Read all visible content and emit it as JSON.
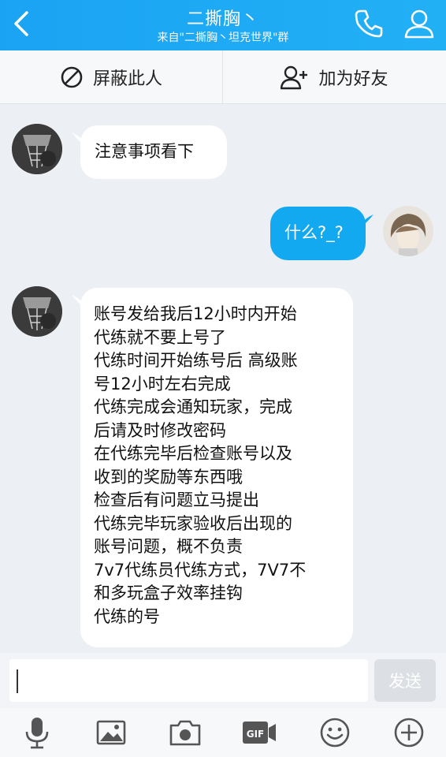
{
  "header": {
    "title": "二撕胸丶",
    "subtitle": "来自\"二撕胸丶坦克世界\"群"
  },
  "actions": {
    "block_label": "屏蔽此人",
    "add_friend_label": "加为好友"
  },
  "messages": [
    {
      "side": "left",
      "text": "注意事项看下"
    },
    {
      "side": "right",
      "text": "什么?_?"
    },
    {
      "side": "left",
      "lines": [
        "账号发给我后12小时内开始",
        "代练就不要上号了",
        "代练时间开始练号后 高级账",
        "号12小时左右完成",
        "代练完成会通知玩家，完成",
        "后请及时修改密码",
        "在代练完毕后检查账号以及",
        "收到的奖励等东西哦",
        "检查后有问题立马提出",
        "代练完毕玩家验收后出现的",
        "账号问题，概不负责",
        "7v7代练员代练方式，7V7不",
        "和多玩盒子效率挂钩",
        "代练的号"
      ]
    }
  ],
  "input": {
    "send_label": "发送"
  },
  "icons": [
    "back-icon",
    "phone-icon",
    "profile-icon",
    "block-icon",
    "add-friend-icon",
    "microphone-icon",
    "image-icon",
    "camera-icon",
    "gif-icon",
    "emoji-icon",
    "plus-icon"
  ],
  "colors": {
    "header": "#1aa3f3",
    "bubble_right": "#13a9f0",
    "bubble_left": "#ffffff",
    "background": "#eceff3"
  }
}
